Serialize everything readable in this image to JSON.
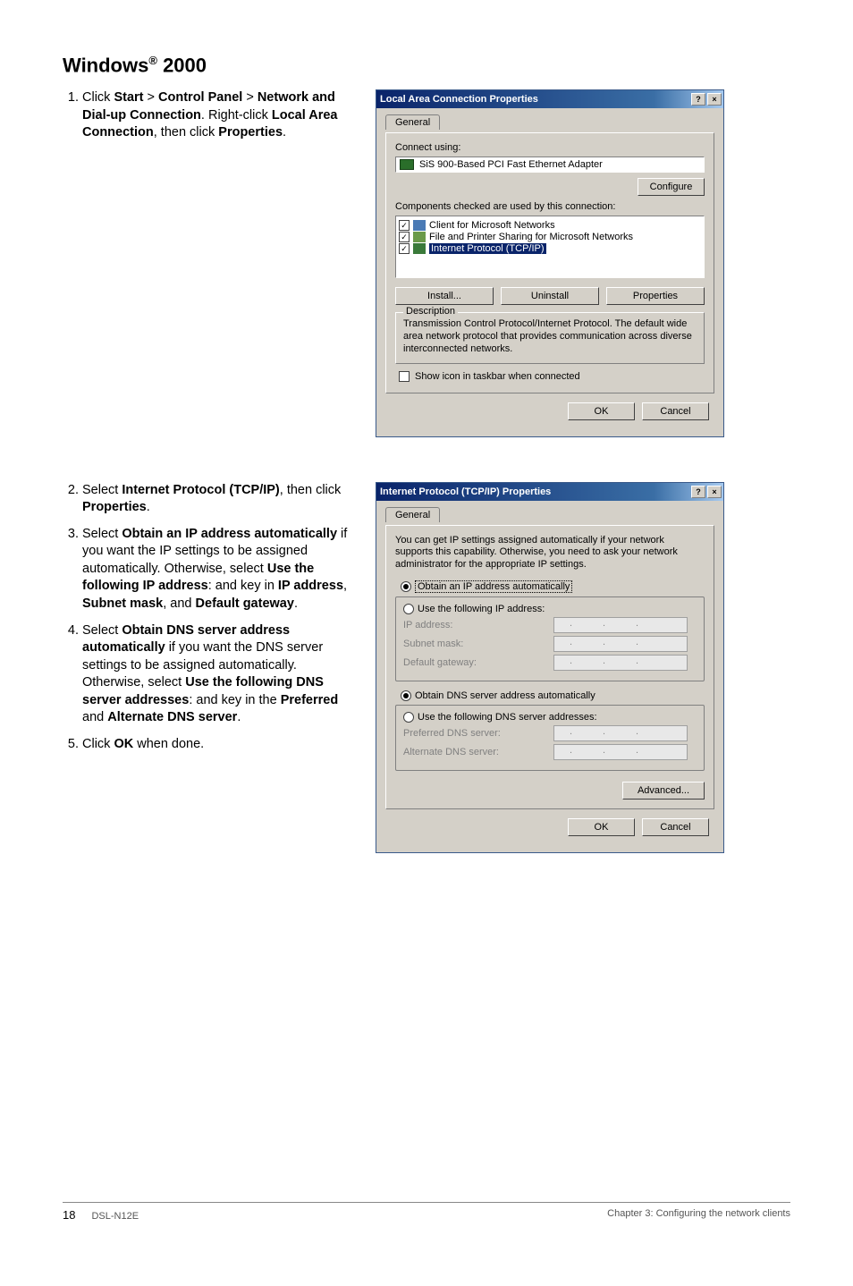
{
  "page": {
    "heading_prefix": "Windows",
    "heading_sup": "®",
    "heading_suffix": " 2000",
    "footer_page": "18",
    "footer_model": "DSL-N12E",
    "footer_chapter": "Chapter 3: Configuring the network clients"
  },
  "step1": {
    "num": "1.",
    "line1a": "Click ",
    "b1": "Start",
    "gt1": " > ",
    "b2": "Control Panel",
    "gt2": " > ",
    "b3": "Network and Dial-up Connection",
    "period1": ". ",
    "line2a": "Right-click ",
    "b4": "Local Area Connection",
    "comma1": ", then click ",
    "b5": "Properties",
    "period2": "."
  },
  "steps2to5": {
    "s2": {
      "num": "2.",
      "a": "Select ",
      "b": "Internet Protocol (TCP/IP)",
      "c": ", then click ",
      "d": "Properties",
      "e": "."
    },
    "s3": {
      "num": "3.",
      "a": "Select ",
      "b": "Obtain an IP address automatically",
      "c": " if you want the IP settings to be assigned automatically. Otherwise, select ",
      "d": "Use the following IP address",
      "e": ": and key in ",
      "f": "IP address",
      "g": ", ",
      "h": "Subnet mask",
      "i": ", and ",
      "j": "Default gateway",
      "k": "."
    },
    "s4": {
      "num": "4.",
      "a": "Select ",
      "b": "Obtain DNS server address automatically",
      "c": " if you want the DNS server settings to be assigned automatically. Otherwise, select ",
      "d": "Use the following DNS server addresses",
      "e": ": and key in the ",
      "f": "Preferred",
      "g": " and ",
      "h": "Alternate DNS server",
      "i": "."
    },
    "s5": {
      "num": "5.",
      "a": "Click ",
      "b": "OK",
      "c": " when done."
    }
  },
  "dlg1": {
    "title": "Local Area Connection Properties",
    "help": "?",
    "close": "×",
    "tab_general": "General",
    "connect_using": "Connect using:",
    "adapter": "SiS 900-Based PCI Fast Ethernet Adapter",
    "configure": "Configure",
    "components_label": "Components checked are used by this connection:",
    "item1": "Client for Microsoft Networks",
    "item2": "File and Printer Sharing for Microsoft Networks",
    "item3": "Internet Protocol (TCP/IP)",
    "install": "Install...",
    "uninstall": "Uninstall",
    "properties": "Properties",
    "desc_title": "Description",
    "desc_text": "Transmission Control Protocol/Internet Protocol. The default wide area network protocol that provides communication across diverse interconnected networks.",
    "taskbar": "Show icon in taskbar when connected",
    "ok": "OK",
    "cancel": "Cancel"
  },
  "dlg2": {
    "title": "Internet Protocol (TCP/IP) Properties",
    "help": "?",
    "close": "×",
    "tab_general": "General",
    "intro": "You can get IP settings assigned automatically if your network supports this capability. Otherwise, you need to ask your network administrator for the appropriate IP settings.",
    "r1": "Obtain an IP address automatically",
    "r2": "Use the following IP address:",
    "ip_label": "IP address:",
    "subnet_label": "Subnet mask:",
    "gateway_label": "Default gateway:",
    "r3": "Obtain DNS server address automatically",
    "r4": "Use the following DNS server addresses:",
    "pdns": "Preferred DNS server:",
    "adns": "Alternate DNS server:",
    "advanced": "Advanced...",
    "ok": "OK",
    "cancel": "Cancel"
  }
}
